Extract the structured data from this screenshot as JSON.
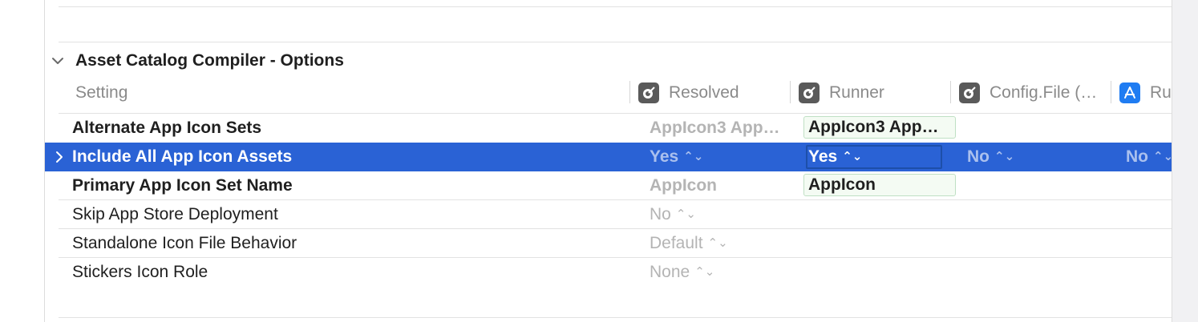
{
  "section": {
    "title": "Asset Catalog Compiler - Options"
  },
  "columns": {
    "setting": "Setting",
    "resolved": "Resolved",
    "runner": "Runner",
    "config_file": "Config.File (…",
    "ru": "Ru"
  },
  "rows": [
    {
      "label": "Alternate App Icon Sets",
      "resolved": "AppIcon3 App…",
      "runner": "AppIcon3 App…"
    },
    {
      "label": "Include All App Icon Assets",
      "resolved": "Yes",
      "runner": "Yes",
      "config": "No",
      "ru": "No"
    },
    {
      "label": "Primary App Icon Set Name",
      "resolved": "AppIcon",
      "runner": "AppIcon"
    },
    {
      "label": "Skip App Store Deployment",
      "resolved": "No"
    },
    {
      "label": "Standalone Icon File Behavior",
      "resolved": "Default"
    },
    {
      "label": "Stickers Icon Role",
      "resolved": "None"
    }
  ],
  "popup_arrows": "⌃⌄",
  "colors": {
    "selection": "#2a62d5",
    "edited_field_border": "#bfe0c4",
    "dimmed_text": "#b4b4b4"
  },
  "icons": {
    "collapse": "chevron-down-icon",
    "expand": "chevron-right-icon",
    "target_column": "xcode-target-icon",
    "app_target_column": "app-store-icon"
  }
}
